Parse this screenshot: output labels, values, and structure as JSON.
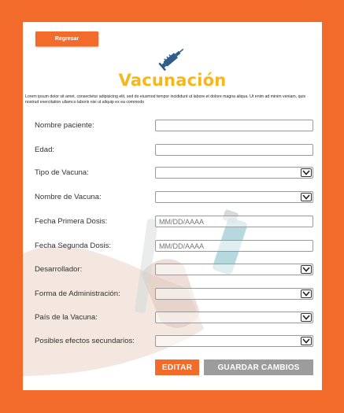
{
  "header": {
    "back_label": "Regresar",
    "title": "Vacunación",
    "intro": "Lorem ipsum dolor sit amet, consectetur adipisicing elit, sed do eiusmod tempor incididunt ut labore et dolore magna aliqua. Ut enim ad minim veniam, quis nostrud exercitation ullamco laboris nisi ut aliquip ex ea commodo"
  },
  "form": {
    "nombre_paciente": {
      "label": "Nombre paciente:",
      "value": ""
    },
    "edad": {
      "label": "Edad:",
      "value": ""
    },
    "tipo_vacuna": {
      "label": "Tipo de Vacuna:",
      "value": ""
    },
    "nombre_vacuna": {
      "label": "Nombre de Vacuna:",
      "value": ""
    },
    "fecha_primera": {
      "label": "Fecha Primera Dosis:",
      "placeholder": "MM/DD/AAAA"
    },
    "fecha_segunda": {
      "label": "Fecha Segunda Dosis:",
      "placeholder": "MM/DD/AAAA"
    },
    "desarrollador": {
      "label": "Desarrollador:",
      "value": ""
    },
    "forma_admin": {
      "label": "Forma de Administración:",
      "value": ""
    },
    "pais_vacuna": {
      "label": "País de la Vacuna:",
      "value": ""
    },
    "efectos": {
      "label": "Posibles efectos secundarios:",
      "value": ""
    }
  },
  "actions": {
    "edit_label": "EDITAR",
    "save_label": "GUARDAR CAMBIOS"
  },
  "colors": {
    "background": "#f26b2a",
    "title": "#f5b71a",
    "icon": "#2e5d8c",
    "save_button": "#9c9c9c"
  },
  "icons": [
    "syringe-icon",
    "chevron-down-icon"
  ]
}
